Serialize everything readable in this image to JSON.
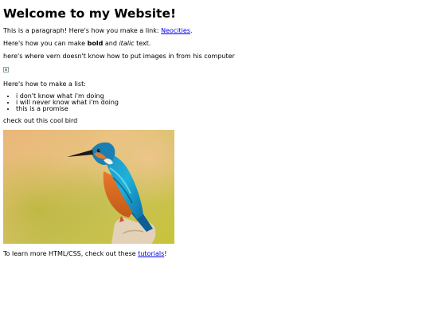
{
  "heading": "Welcome to my Website!",
  "p1": {
    "text": "This is a paragraph! Here's how you make a link: ",
    "link": "Neocities",
    "end": "."
  },
  "p2": {
    "pre": "Here's how you can make ",
    "bold": "bold",
    "mid": " and ",
    "italic": "italic",
    "end": " text."
  },
  "p3": "here's where vern doesn't know how to put images in from his computer",
  "list_intro": "Here's how to make a list:",
  "list_items": [
    "i don't know what i'm doing",
    "i will never know what i'm doing",
    "this is a promise"
  ],
  "bird_caption": "check out this cool bird",
  "footer": {
    "pre": "To learn more HTML/CSS, check out these ",
    "link": "tutorials",
    "end": "!"
  }
}
